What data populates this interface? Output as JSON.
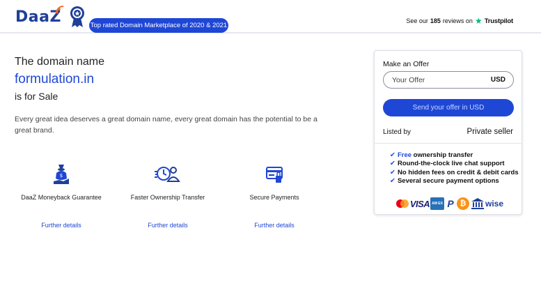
{
  "header": {
    "logo_text": "DaaZ",
    "tagline": "Top rated Domain Marketplace of 2020 & 2021",
    "reviews": {
      "prefix": "See our",
      "count": "185",
      "suffix": "reviews on",
      "brand": "Trustpilot"
    }
  },
  "intro": {
    "line1": "The domain name",
    "domain": "formulation.in",
    "line2": "is for Sale",
    "description": "Every great idea deserves a great domain name, every great domain has the potential to be a great brand."
  },
  "features": [
    {
      "icon": "moneyback-icon",
      "title": "DaaZ Moneyback Guarantee",
      "link": "Further details"
    },
    {
      "icon": "fast-transfer-icon",
      "title": "Faster Ownership Transfer",
      "link": "Further details"
    },
    {
      "icon": "secure-payment-icon",
      "title": "Secure Payments",
      "link": "Further details"
    }
  ],
  "offer": {
    "heading": "Make an Offer",
    "input_placeholder": "Your Offer",
    "currency": "USD",
    "button": "Send your offer in USD",
    "listed_label": "Listed by",
    "seller": "Private seller",
    "benefits": [
      {
        "highlight": "Free",
        "text": " ownership transfer"
      },
      {
        "highlight": "",
        "text": "Round-the-clock live chat support"
      },
      {
        "highlight": "",
        "text": "No hidden fees on credit & debit cards"
      },
      {
        "highlight": "",
        "text": "Several secure payment options"
      }
    ],
    "payment_methods": [
      {
        "name": "mastercard-icon",
        "label": ""
      },
      {
        "name": "visa-icon",
        "label": "VISA"
      },
      {
        "name": "amex-icon",
        "label": "AM EX"
      },
      {
        "name": "paypal-icon",
        "label": "P"
      },
      {
        "name": "bitcoin-icon",
        "label": "₿"
      },
      {
        "name": "bank-transfer-icon",
        "label": ""
      },
      {
        "name": "wise-icon",
        "label": "wise"
      }
    ]
  },
  "colors": {
    "brand_blue": "#1f47d6",
    "logo_blue": "#1f3f99",
    "trustpilot_green": "#00b67a"
  }
}
